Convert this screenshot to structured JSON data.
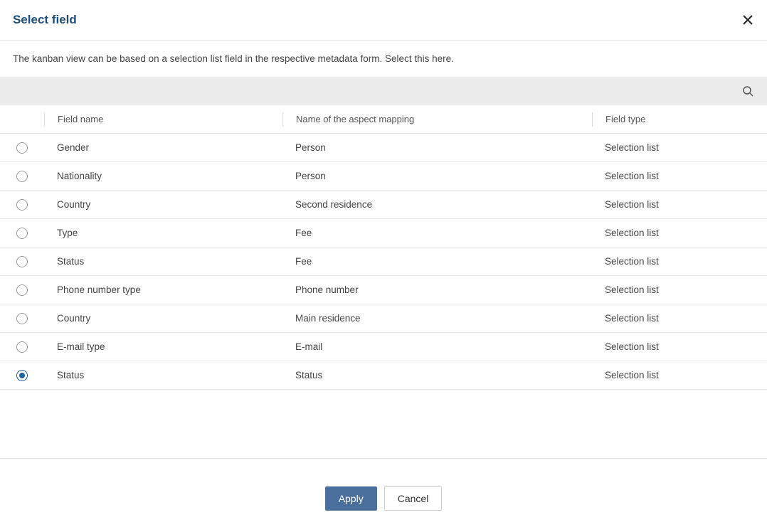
{
  "header": {
    "title": "Select field"
  },
  "description": "The kanban view can be based on a selection list field in the respective metadata form. Select this here.",
  "table": {
    "columns": {
      "fieldname": "Field name",
      "aspect": "Name of the aspect mapping",
      "fieldtype": "Field type"
    },
    "rows": [
      {
        "fieldname": "Gender",
        "aspect": "Person",
        "fieldtype": "Selection list",
        "selected": false
      },
      {
        "fieldname": "Nationality",
        "aspect": "Person",
        "fieldtype": "Selection list",
        "selected": false
      },
      {
        "fieldname": "Country",
        "aspect": "Second residence",
        "fieldtype": "Selection list",
        "selected": false
      },
      {
        "fieldname": "Type",
        "aspect": "Fee",
        "fieldtype": "Selection list",
        "selected": false
      },
      {
        "fieldname": "Status",
        "aspect": "Fee",
        "fieldtype": "Selection list",
        "selected": false
      },
      {
        "fieldname": "Phone number type",
        "aspect": "Phone number",
        "fieldtype": "Selection list",
        "selected": false
      },
      {
        "fieldname": "Country",
        "aspect": "Main residence",
        "fieldtype": "Selection list",
        "selected": false
      },
      {
        "fieldname": "E-mail type",
        "aspect": "E-mail",
        "fieldtype": "Selection list",
        "selected": false
      },
      {
        "fieldname": "Status",
        "aspect": "Status",
        "fieldtype": "Selection list",
        "selected": true
      }
    ]
  },
  "footer": {
    "apply": "Apply",
    "cancel": "Cancel"
  }
}
